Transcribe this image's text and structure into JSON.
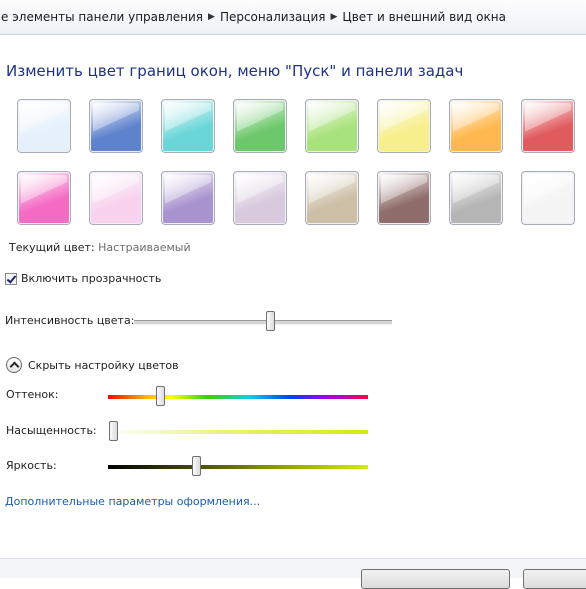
{
  "breadcrumb": [
    "е элементы панели управления",
    "Персонализация",
    "Цвет и внешний вид окна"
  ],
  "headline": "Изменить цвет границ окон, меню \"Пуск\" и панели задач",
  "swatches": [
    {
      "color": "#e6f0fb"
    },
    {
      "color": "#5e82cc"
    },
    {
      "color": "#6ad6d8"
    },
    {
      "color": "#6cc86a"
    },
    {
      "color": "#a8e27c"
    },
    {
      "color": "#f7ee8c"
    },
    {
      "color": "#ffb84e"
    },
    {
      "color": "#e05a5e"
    },
    {
      "color": "#f46bc4"
    },
    {
      "color": "#f8d2ef"
    },
    {
      "color": "#a893cf"
    },
    {
      "color": "#d8c9de"
    },
    {
      "color": "#cdbfa6"
    },
    {
      "color": "#8f6d6a"
    },
    {
      "color": "#b5b5b5"
    },
    {
      "color": "#f4f4f4"
    }
  ],
  "current_color_label": "Текущий цвет:",
  "current_color_value": "Настраиваемый",
  "transparency_label": "Включить прозрачность",
  "transparency_checked": true,
  "intensity_label": "Интенсивность цвета:",
  "intensity_value": 0.53,
  "color_mixer_toggle_label": "Скрыть настройку цветов",
  "hue_label": "Оттенок:",
  "hue_value": 0.2,
  "saturation_label": "Насыщенность:",
  "saturation_value": 0.02,
  "brightness_label": "Яркость:",
  "brightness_value": 0.34,
  "advanced_link": "Дополнительные параметры оформления..."
}
